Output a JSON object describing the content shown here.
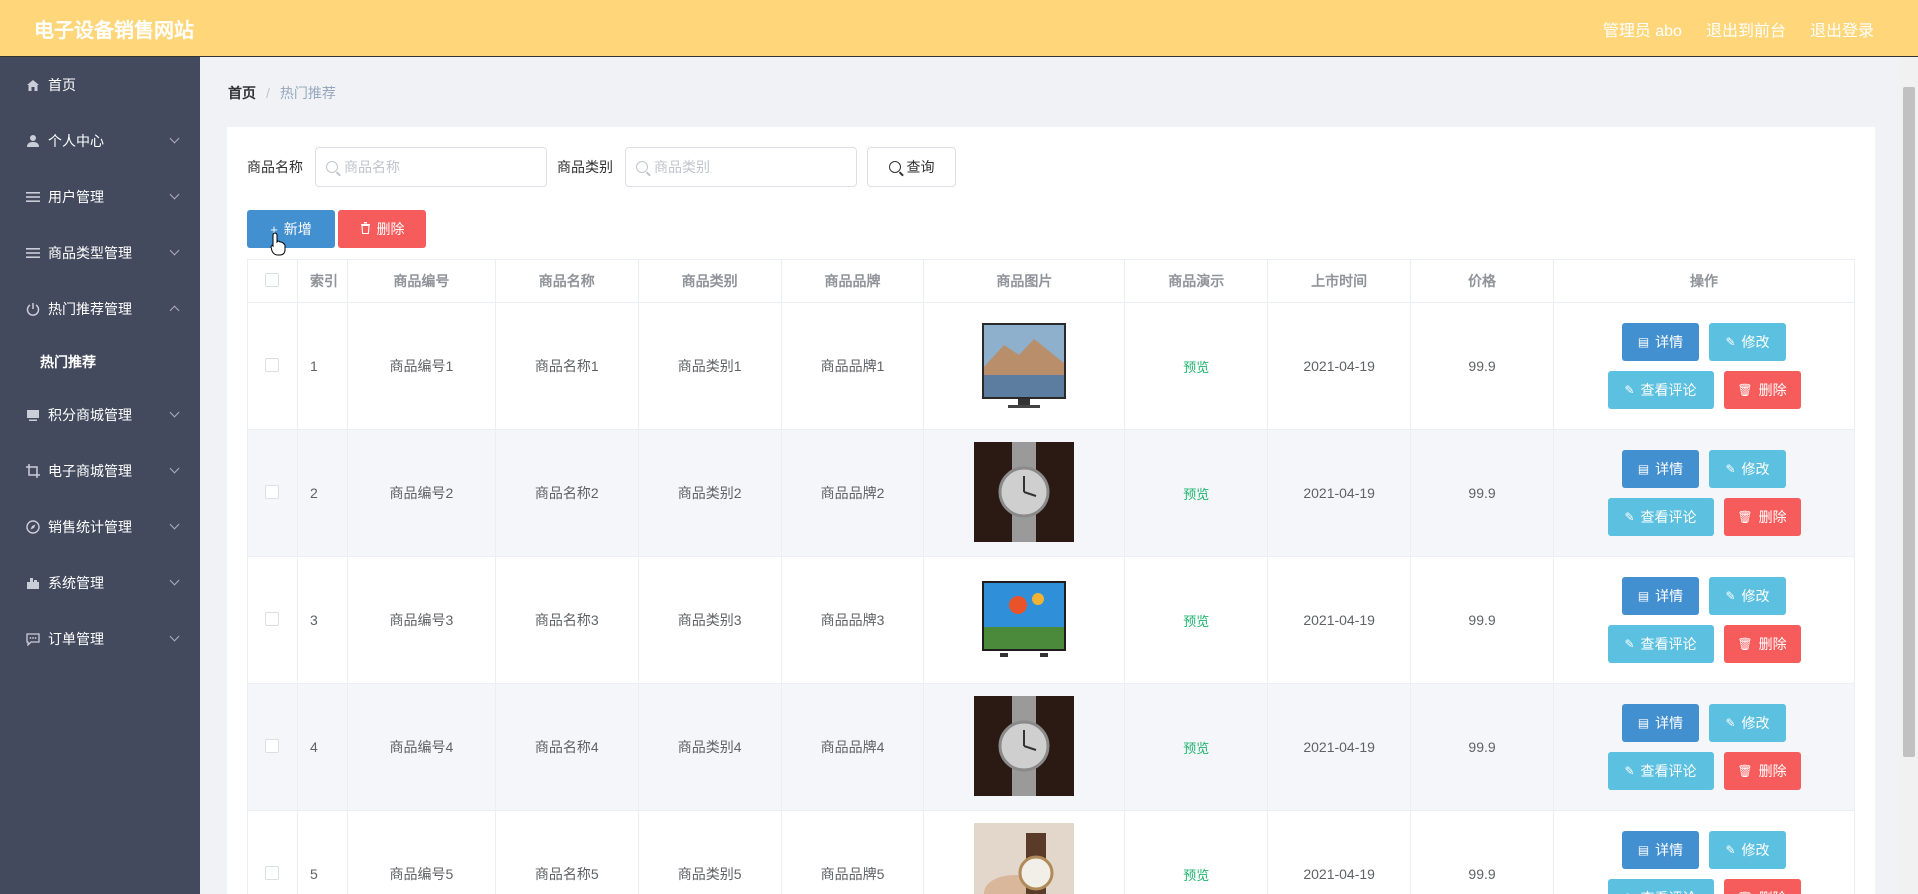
{
  "header": {
    "title": "电子设备销售网站",
    "admin": "管理员 abo",
    "front": "退出到前台",
    "logout": "退出登录",
    "bg_color": "#ffd77a"
  },
  "sidebar": {
    "items": [
      {
        "label": "首页",
        "icon": "home-icon"
      },
      {
        "label": "个人中心",
        "icon": "user-icon"
      },
      {
        "label": "用户管理",
        "icon": "menu-icon"
      },
      {
        "label": "商品类型管理",
        "icon": "menu-icon"
      },
      {
        "label": "热门推荐管理",
        "icon": "power-icon",
        "expanded": true,
        "children": [
          "热门推荐"
        ]
      },
      {
        "label": "积分商城管理",
        "icon": "monitor-icon"
      },
      {
        "label": "电子商城管理",
        "icon": "crop-icon"
      },
      {
        "label": "销售统计管理",
        "icon": "compass-icon"
      },
      {
        "label": "系统管理",
        "icon": "office-icon"
      },
      {
        "label": "订单管理",
        "icon": "chat-icon"
      }
    ]
  },
  "breadcrumb": {
    "home": "首页",
    "current": "热门推荐"
  },
  "search": {
    "name_label": "商品名称",
    "name_placeholder": "商品名称",
    "type_label": "商品类别",
    "type_placeholder": "商品类别",
    "query": "查询"
  },
  "actions": {
    "add": "新增",
    "delete": "删除"
  },
  "table": {
    "headers": [
      "索引",
      "商品编号",
      "商品名称",
      "商品类别",
      "商品品牌",
      "商品图片",
      "商品演示",
      "上市时间",
      "价格",
      "操作"
    ],
    "preview_label": "预览",
    "op_labels": {
      "detail": "详情",
      "edit": "修改",
      "comment": "查看评论",
      "delete": "删除"
    },
    "rows": [
      {
        "index": "1",
        "code": "商品编号1",
        "name": "商品名称1",
        "type": "商品类别1",
        "brand": "商品品牌1",
        "image": "tv-image",
        "date": "2021-04-19",
        "price": "99.9"
      },
      {
        "index": "2",
        "code": "商品编号2",
        "name": "商品名称2",
        "type": "商品类别2",
        "brand": "商品品牌2",
        "image": "watch-image",
        "date": "2021-04-19",
        "price": "99.9"
      },
      {
        "index": "3",
        "code": "商品编号3",
        "name": "商品名称3",
        "type": "商品类别3",
        "brand": "商品品牌3",
        "image": "tv-balloon-image",
        "date": "2021-04-19",
        "price": "99.9"
      },
      {
        "index": "4",
        "code": "商品编号4",
        "name": "商品名称4",
        "type": "商品类别4",
        "brand": "商品品牌4",
        "image": "watch-image",
        "date": "2021-04-19",
        "price": "99.9"
      },
      {
        "index": "5",
        "code": "商品编号5",
        "name": "商品名称5",
        "type": "商品类别5",
        "brand": "商品品牌5",
        "image": "watch-hand-image",
        "date": "2021-04-19",
        "price": "99.9"
      }
    ]
  }
}
